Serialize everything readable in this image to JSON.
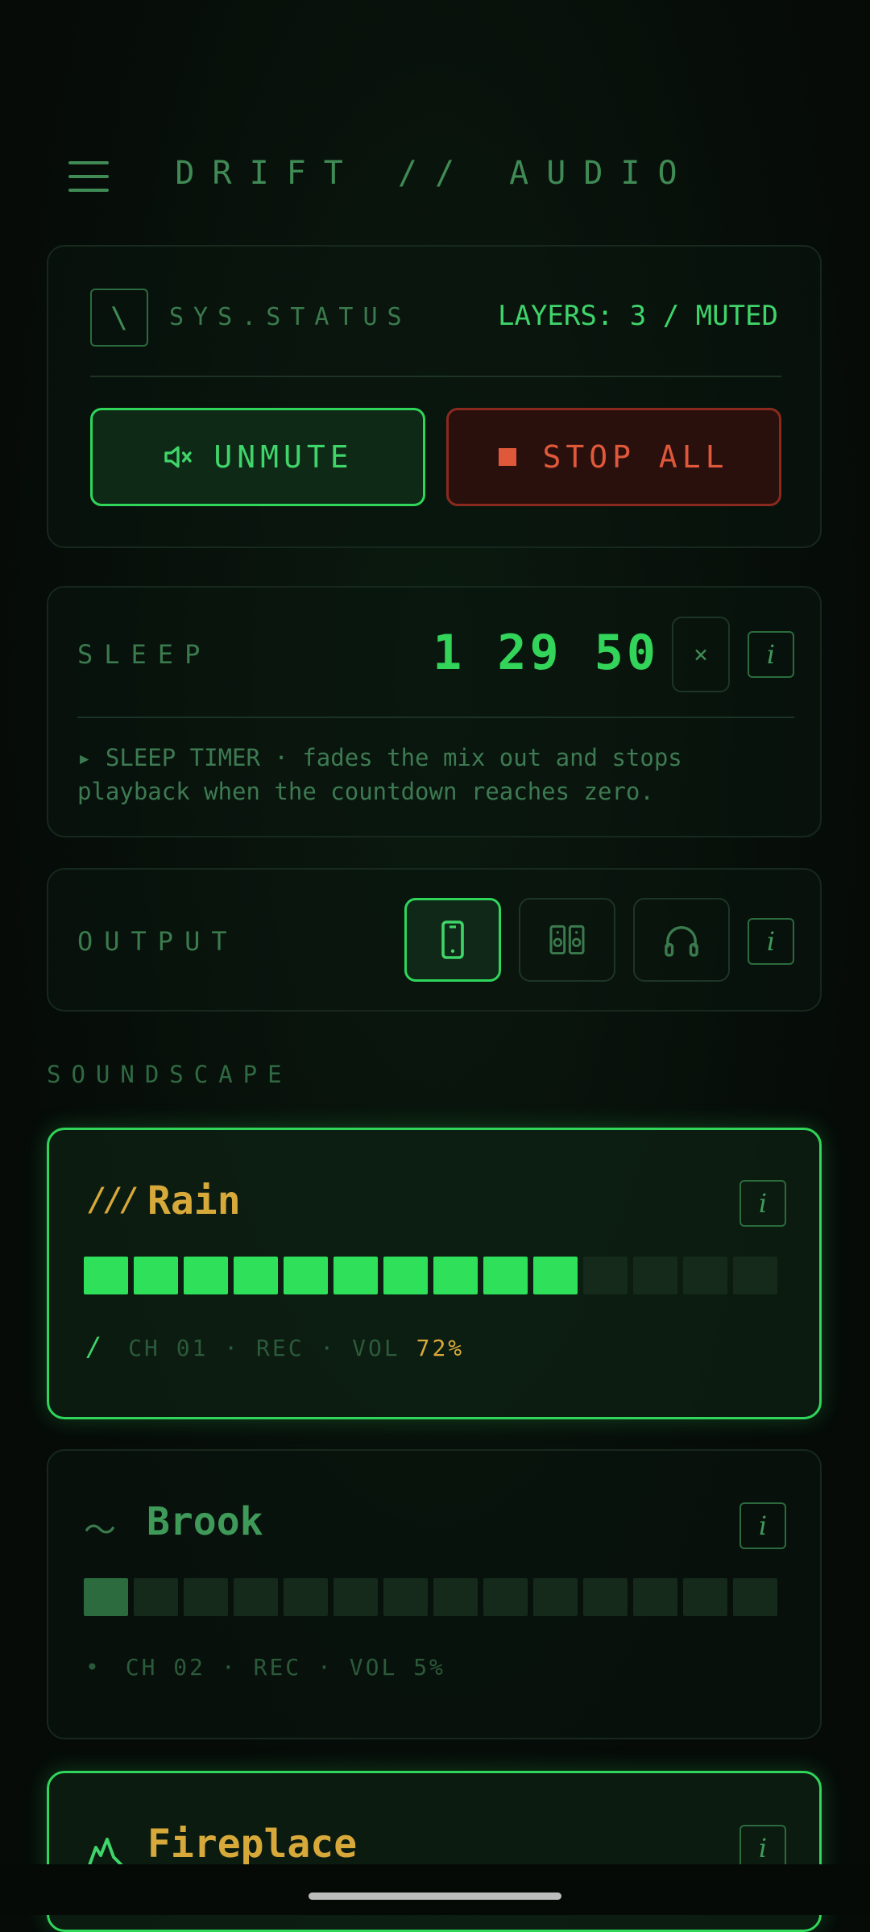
{
  "header": {
    "title": "DRIFT // AUDIO"
  },
  "status": {
    "icon_glyph": "\\",
    "label": "SYS.STATUS",
    "layers": "LAYERS: 3 / MUTED",
    "unmute_label": "UNMUTE",
    "stop_label": "STOP ALL"
  },
  "sleep": {
    "label": "SLEEP",
    "time": "1 29 50",
    "close_glyph": "×",
    "info_glyph": "i",
    "description": "▸ SLEEP TIMER · fades the mix out and stops playback when the countdown reaches zero."
  },
  "output": {
    "label": "OUTPUT",
    "info_glyph": "i",
    "options": [
      "phone",
      "speakers",
      "headphones"
    ],
    "selected": "phone"
  },
  "soundscape": {
    "label": "SOUNDSCAPE",
    "tracks": [
      {
        "name": "Rain",
        "icon_glyph": "///",
        "meta_prefix": "/",
        "channel": "CH 01",
        "mode": "REC",
        "vol_label": "VOL",
        "volume": "72%",
        "active": true,
        "level": 10,
        "segments": 14
      },
      {
        "name": "Brook",
        "icon_glyph": "〜",
        "meta_prefix": "•",
        "channel": "CH 02",
        "mode": "REC",
        "vol_label": "VOL",
        "volume": "5%",
        "active": false,
        "level": 1,
        "segments": 14
      },
      {
        "name": "Fireplace",
        "active": true
      }
    ]
  },
  "colors": {
    "accent": "#2fd65a",
    "warning": "#e0583a",
    "title_gold": "#d7a93a"
  }
}
